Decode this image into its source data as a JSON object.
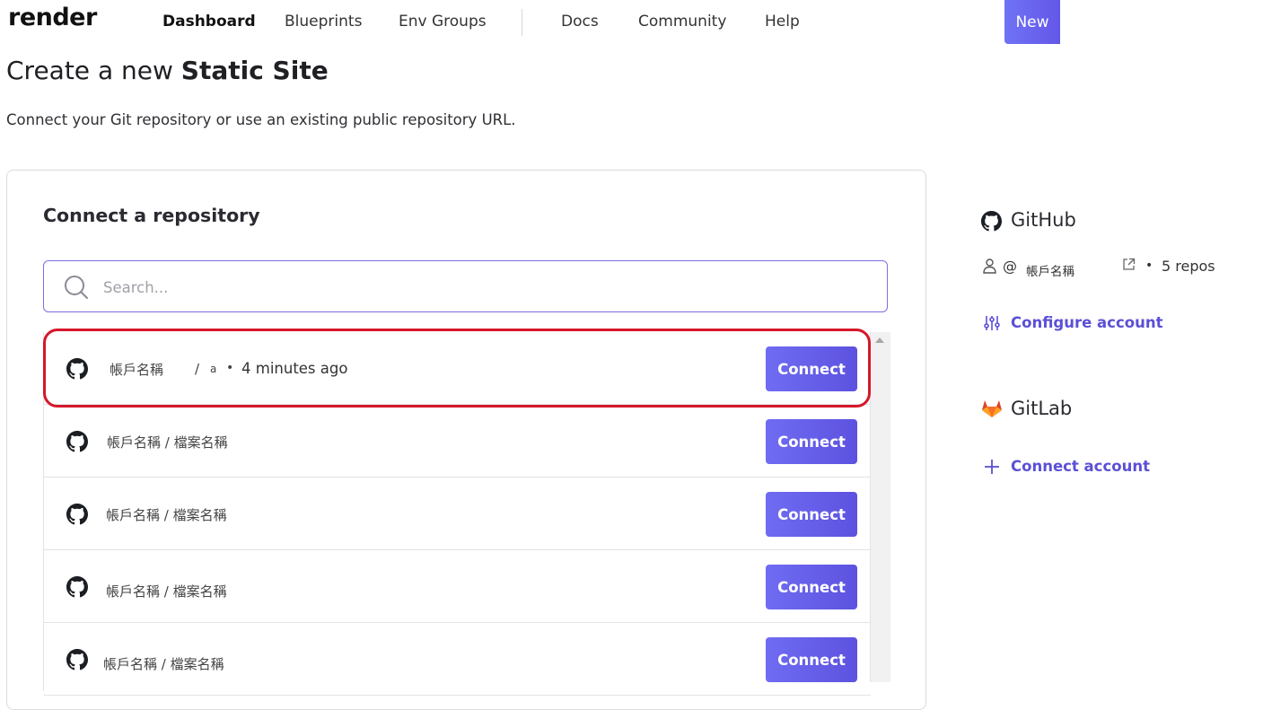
{
  "header": {
    "logo": "render",
    "nav": [
      "Dashboard",
      "Blueprints",
      "Env Groups",
      "Docs",
      "Community",
      "Help"
    ],
    "new_button": "New"
  },
  "page": {
    "title_prefix": "Create a new",
    "title_bold": "Static Site",
    "subtitle": "Connect your Git repository or use an existing public repository URL."
  },
  "repo_card": {
    "title": "Connect a repository",
    "search_placeholder": "Search...",
    "first_repo": {
      "account": "帳戶名稱",
      "separator": "/",
      "short_name": "a",
      "dot": "•",
      "updated": "4 minutes ago",
      "button": "Connect"
    },
    "repos": [
      {
        "name": "帳戶名稱 / 檔案名稱",
        "button": "Connect"
      },
      {
        "name": "帳戶名稱 / 檔案名稱",
        "button": "Connect"
      },
      {
        "name": "帳戶名稱 / 檔案名稱",
        "button": "Connect"
      },
      {
        "name": "帳戶名稱 / 檔案名稱",
        "button": "Connect"
      }
    ]
  },
  "github": {
    "title": "GitHub",
    "at": "@",
    "account": "帳戶名稱",
    "dot": "•",
    "repos": "5 repos",
    "configure": "Configure account"
  },
  "gitlab": {
    "title": "GitLab",
    "connect": "Connect account"
  },
  "colors": {
    "accent": "#6457e8",
    "link": "#5b50d6",
    "highlight_box": "#d6172a",
    "gitlab_orange": "#e2432a"
  }
}
